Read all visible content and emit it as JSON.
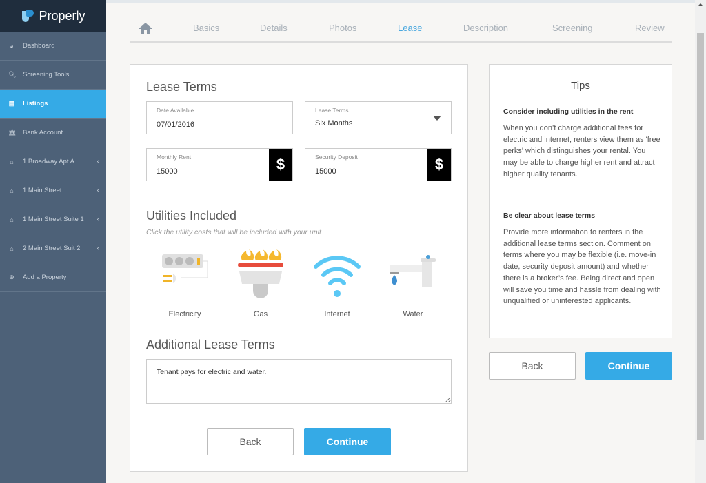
{
  "app": {
    "name": "Properly"
  },
  "sidebar": {
    "items": [
      {
        "label": "Dashboard",
        "icon": "dashboard-icon",
        "glyph": "◕",
        "active": false,
        "chevron": false
      },
      {
        "label": "Screening Tools",
        "icon": "search-icon",
        "glyph": "🔍︎",
        "active": false,
        "chevron": false
      },
      {
        "label": "Listings",
        "icon": "document-icon",
        "glyph": "▤",
        "active": true,
        "chevron": false
      },
      {
        "label": "Bank Account",
        "icon": "bank-icon",
        "glyph": "🏛︎",
        "active": false,
        "chevron": false
      },
      {
        "label": "1 Broadway Apt A",
        "icon": "home-icon",
        "glyph": "⌂",
        "active": false,
        "chevron": true
      },
      {
        "label": "1 Main Street",
        "icon": "home-icon",
        "glyph": "⌂",
        "active": false,
        "chevron": true
      },
      {
        "label": "1 Main Street Suite 1",
        "icon": "home-icon",
        "glyph": "⌂",
        "active": false,
        "chevron": true
      },
      {
        "label": "2 Main Street Suit 2",
        "icon": "home-icon",
        "glyph": "⌂",
        "active": false,
        "chevron": true
      },
      {
        "label": "Add a Property",
        "icon": "plus-circle-icon",
        "glyph": "⊕",
        "active": false,
        "chevron": false
      }
    ]
  },
  "tabs": [
    {
      "label": "Basics"
    },
    {
      "label": "Details"
    },
    {
      "label": "Photos"
    },
    {
      "label": "Lease",
      "active": true
    },
    {
      "label": "Description"
    },
    {
      "label": "Screening"
    },
    {
      "label": "Review"
    }
  ],
  "lease": {
    "title": "Lease Terms",
    "date_label": "Date Available",
    "date_value": "07/01/2016",
    "terms_label": "Lease Terms",
    "terms_value": "Six Months",
    "rent_label": "Monthly Rent",
    "rent_value": "15000",
    "deposit_label": "Security Deposit",
    "deposit_value": "15000",
    "currency": "$"
  },
  "utilities": {
    "title": "Utilities Included",
    "subtitle": "Click the utility costs that will be included with your unit",
    "items": [
      {
        "label": "Electricity"
      },
      {
        "label": "Gas"
      },
      {
        "label": "Internet"
      },
      {
        "label": "Water"
      }
    ]
  },
  "additional": {
    "title": "Additional Lease Terms",
    "value": "Tenant pays for electric and water."
  },
  "buttons": {
    "back": "Back",
    "continue": "Continue"
  },
  "tips": {
    "title": "Tips",
    "h1": "Consider including utilities in the rent",
    "p1": "When you don’t charge additional fees for electric and internet, renters view them as 'free perks' which distinguishes your rental. You may be able to charge higher rent and attract higher quality tenants.",
    "h2": "Be clear about lease terms",
    "p2": "Provide more information to renters in the additional lease terms section. Comment on terms where you may be flexible (i.e. move-in date, security deposit amount) and whether there is a broker’s fee. Being direct and open will save you time and hassle from dealing with unqualified or uninterested applicants."
  },
  "colors": {
    "accent": "#35aae6",
    "sidebar": "#4d6178",
    "sidebar_header": "#1f2d3d"
  }
}
